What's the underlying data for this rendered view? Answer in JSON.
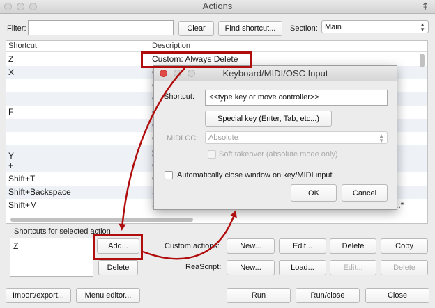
{
  "window": {
    "title": "Actions"
  },
  "filter": {
    "label": "Filter:",
    "value": "",
    "clear": "Clear",
    "find_shortcut": "Find shortcut...",
    "section_label": "Section:",
    "section_value": "Main"
  },
  "table": {
    "headers": {
      "shortcut": "Shortcut",
      "description": "Description"
    },
    "rows": [
      {
        "shortcut": "Z",
        "description": "Custom: Always Delete"
      },
      {
        "shortcut": "X",
        "description": "C"
      },
      {
        "shortcut": "",
        "description": "C"
      },
      {
        "shortcut": "",
        "description": "C"
      },
      {
        "shortcut": "F",
        "description": "C"
      },
      {
        "shortcut": "",
        "description": "C"
      },
      {
        "shortcut": "",
        "description": "C"
      },
      {
        "shortcut": "",
        "description": "C"
      },
      {
        "shortcut": "Y",
        "description": "C"
      },
      {
        "shortcut": "+",
        "description": "C"
      },
      {
        "shortcut": "Shift+T",
        "description": "C"
      },
      {
        "shortcut": "Shift+Backspace",
        "description": "S"
      },
      {
        "shortcut": "Shift+M",
        "description": "S"
      }
    ],
    "trailing_text": "..*"
  },
  "dialog": {
    "title": "Keyboard/MIDI/OSC Input",
    "shortcut_label": "Shortcut:",
    "shortcut_value": "<<type key or move controller>>",
    "special_key": "Special key (Enter, Tab, etc...)",
    "midi_cc_label": "MIDI CC:",
    "midi_cc_value": "Absolute",
    "soft_takeover": "Soft takeover (absolute mode only)",
    "auto_close": "Automatically close window on key/MIDI input",
    "ok": "OK",
    "cancel": "Cancel"
  },
  "shortcuts_section": {
    "label": "Shortcuts for selected action",
    "items": [
      "Z"
    ],
    "add": "Add...",
    "delete": "Delete"
  },
  "custom_actions": {
    "label": "Custom actions:",
    "new": "New...",
    "edit": "Edit...",
    "delete": "Delete",
    "copy": "Copy"
  },
  "reascript": {
    "label": "ReaScript:",
    "new": "New...",
    "load": "Load...",
    "edit": "Edit...",
    "delete": "Delete"
  },
  "bottom": {
    "import_export": "Import/export...",
    "menu_editor": "Menu editor...",
    "run": "Run",
    "run_close": "Run/close",
    "close": "Close"
  },
  "colors": {
    "annotation": "#b00d0d",
    "window_bg": "#ececec",
    "close_button": "#e14b45"
  },
  "icons": {
    "pin": "pin-icon",
    "dropdown": "up-down-arrows-icon"
  }
}
